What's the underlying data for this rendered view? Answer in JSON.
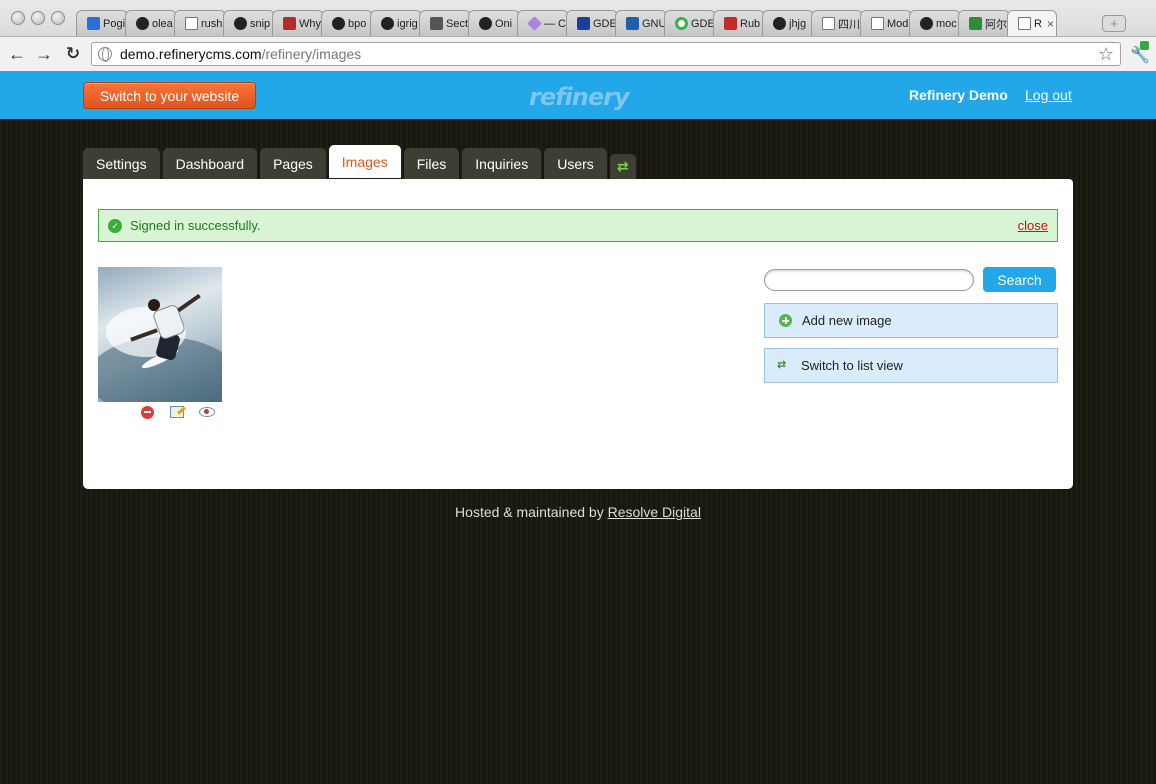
{
  "browser": {
    "tabs": [
      {
        "label": "Pogi",
        "icon": "blue-bars-icon"
      },
      {
        "label": "olea",
        "icon": "github-icon"
      },
      {
        "label": "rush",
        "icon": "document-icon"
      },
      {
        "label": "snip",
        "icon": "github-icon"
      },
      {
        "label": "Why",
        "icon": "red-box-icon"
      },
      {
        "label": "bpo",
        "icon": "github-icon"
      },
      {
        "label": "igrig",
        "icon": "github-icon"
      },
      {
        "label": "Sect",
        "icon": "section-icon"
      },
      {
        "label": "Oni",
        "icon": "github-icon"
      },
      {
        "label": "— C",
        "icon": "purple-diamond-icon"
      },
      {
        "label": "GDE",
        "icon": "ub-icon"
      },
      {
        "label": "GNU",
        "icon": "ibm-icon"
      },
      {
        "label": "GDE",
        "icon": "green-ring-icon"
      },
      {
        "label": "Rub",
        "icon": "red-rail-icon"
      },
      {
        "label": "jhjg",
        "icon": "github-icon"
      },
      {
        "label": "四川",
        "icon": "document-icon"
      },
      {
        "label": "Mod",
        "icon": "document-icon"
      },
      {
        "label": "moc",
        "icon": "github-icon"
      },
      {
        "label": "阿尔",
        "icon": "green-square-icon"
      },
      {
        "label": "R",
        "icon": "document-icon",
        "active": true
      }
    ],
    "new_tab_label": "+",
    "url_host": "demo.refinerycms.com",
    "url_path": "/refinery/images"
  },
  "header": {
    "switch_label": "Switch to your website",
    "logo": "refinery",
    "site_name": "Refinery Demo",
    "logout_label": "Log out"
  },
  "menu": {
    "tabs": [
      "Settings",
      "Dashboard",
      "Pages",
      "Images",
      "Files",
      "Inquiries",
      "Users"
    ],
    "active": "Images"
  },
  "flash": {
    "message": "Signed in successfully.",
    "close_label": "close"
  },
  "actions": {
    "search_placeholder": "",
    "search_button": "Search",
    "add_image": "Add new image",
    "switch_view": "Switch to list view"
  },
  "footer": {
    "prefix": "Hosted & maintained by",
    "link": "Resolve Digital"
  },
  "colors": {
    "header_blue": "#22a7e8",
    "switch_orange": "#e3531c",
    "active_tab_text": "#e35715",
    "flash_green": "#3bb03b",
    "action_box": "#daecfb"
  }
}
